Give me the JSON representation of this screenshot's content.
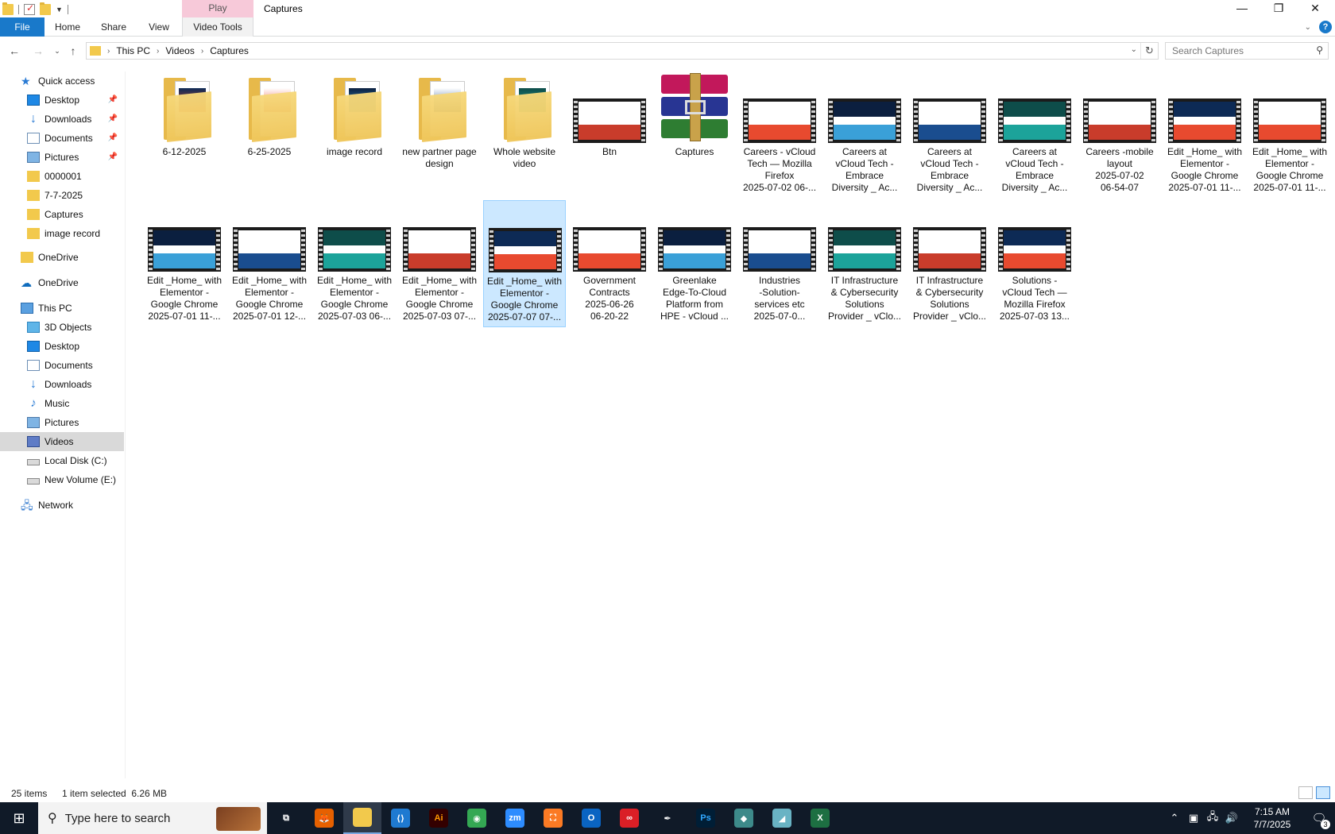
{
  "window": {
    "title": "Captures",
    "contextual_tab": "Play",
    "controls": [
      "—",
      "❐",
      "✕"
    ]
  },
  "ribbon": {
    "file": "File",
    "home": "Home",
    "share": "Share",
    "view": "View",
    "video_tools": "Video Tools"
  },
  "address": {
    "crumbs": [
      "This PC",
      "Videos",
      "Captures"
    ]
  },
  "search": {
    "placeholder": "Search Captures"
  },
  "sidebar": {
    "quick_access": "Quick access",
    "qa_items": [
      "Desktop",
      "Downloads",
      "Documents",
      "Pictures",
      "0000001",
      "7-7-2025",
      "Captures",
      "image record"
    ],
    "onedrive_personal": "OneDrive",
    "onedrive": "OneDrive",
    "this_pc": "This PC",
    "pc_items": [
      "3D Objects",
      "Desktop",
      "Documents",
      "Downloads",
      "Music",
      "Pictures",
      "Videos",
      "Local Disk (C:)",
      "New Volume (E:)"
    ],
    "network": "Network"
  },
  "items": [
    {
      "label": "6-12-2025",
      "kind": "folder"
    },
    {
      "label": "6-25-2025",
      "kind": "folder"
    },
    {
      "label": "image record",
      "kind": "folder"
    },
    {
      "label": "new partner page\ndesign",
      "kind": "folder"
    },
    {
      "label": "Whole website\nvideo",
      "kind": "folder"
    },
    {
      "label": "Btn",
      "kind": "video"
    },
    {
      "label": "Captures",
      "kind": "archive"
    },
    {
      "label": "Careers - vCloud\nTech — Mozilla\nFirefox\n2025-07-02 06-...",
      "kind": "video"
    },
    {
      "label": "Careers at\nvCloud Tech -\nEmbrace\nDiversity _ Ac...",
      "kind": "video"
    },
    {
      "label": "Careers at\nvCloud Tech -\nEmbrace\nDiversity _ Ac...",
      "kind": "video"
    },
    {
      "label": "Careers at\nvCloud Tech -\nEmbrace\nDiversity _ Ac...",
      "kind": "video"
    },
    {
      "label": "Careers -mobile\nlayout\n2025-07-02\n06-54-07",
      "kind": "video"
    },
    {
      "label": "Edit _Home_ with\nElementor -\nGoogle Chrome\n2025-07-01 11-...",
      "kind": "video"
    },
    {
      "label": "Edit _Home_ with\nElementor -\nGoogle Chrome\n2025-07-01 11-...",
      "kind": "video"
    },
    {
      "label": "Edit _Home_ with\nElementor -\nGoogle Chrome\n2025-07-01 11-...",
      "kind": "video"
    },
    {
      "label": "Edit _Home_ with\nElementor -\nGoogle Chrome\n2025-07-01 12-...",
      "kind": "video"
    },
    {
      "label": "Edit _Home_ with\nElementor -\nGoogle Chrome\n2025-07-03 06-...",
      "kind": "video"
    },
    {
      "label": "Edit _Home_ with\nElementor -\nGoogle Chrome\n2025-07-03 07-...",
      "kind": "video"
    },
    {
      "label": "Edit _Home_ with\nElementor -\nGoogle Chrome\n2025-07-07 07-...",
      "kind": "video",
      "selected": true
    },
    {
      "label": "Government\nContracts\n2025-06-26\n06-20-22",
      "kind": "video"
    },
    {
      "label": "Greenlake\nEdge-To-Cloud\nPlatform from\nHPE - vCloud ...",
      "kind": "video"
    },
    {
      "label": "Industries\n-Solution-\nservices etc\n2025-07-0...",
      "kind": "video"
    },
    {
      "label": "IT Infrastructure\n& Cybersecurity\nSolutions\nProvider _ vClo...",
      "kind": "video"
    },
    {
      "label": "IT Infrastructure\n& Cybersecurity\nSolutions\nProvider _ vClo...",
      "kind": "video"
    },
    {
      "label": "Solutions -\nvCloud Tech —\nMozilla Firefox\n2025-07-03 13...",
      "kind": "video"
    }
  ],
  "status": {
    "count": "25 items",
    "selection": "1 item selected  6.26 MB"
  },
  "taskbar": {
    "search_placeholder": "Type here to search",
    "apps": [
      "Task View",
      "Firefox",
      "File Explorer",
      "VS Code",
      "Illustrator",
      "Chrome",
      "Zoom",
      "XAMPP",
      "Outlook",
      "Creative Cloud",
      "Pen tool",
      "Photoshop",
      "App",
      "App",
      "Excel"
    ],
    "time": "7:15 AM",
    "date": "7/7/2025",
    "notifications": "3"
  },
  "colors": {
    "accent": "#1979ca",
    "selection": "#cce8ff",
    "folder": "#f2c94c",
    "taskbar": "#101a28"
  }
}
